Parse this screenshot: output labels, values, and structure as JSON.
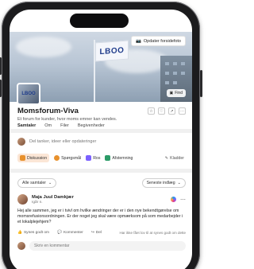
{
  "cover": {
    "update_button": "Opdater forsidefoto",
    "find_chip": "Find",
    "flag_text": "LBOO",
    "logo_text": "LBOO"
  },
  "community": {
    "title": "Momsforum-Viva",
    "description": "Et forum for kunder, hvor moms emner kan vendes.",
    "tabs": [
      "Samtaler",
      "Om",
      "Filer",
      "Begivenheder"
    ]
  },
  "composer": {
    "placeholder": "Del tanker, ideer eller opdateringer",
    "post_types": [
      "Diskussion",
      "Spørgsmål",
      "Ros",
      "Afstemning"
    ],
    "drafts_label": "Kladder"
  },
  "filter": {
    "all_conversations": "Alle samtaler",
    "sort": "Seneste indlæg"
  },
  "post": {
    "author": "Maja Juul Damkjær",
    "time": "Igår n.",
    "body": "Hej alle sammen, jeg er i tvivl om hvilke ændringer der er i den nye bekendtgørelse om momsrefusionsordningen. Er der noget jeg skal være opmærksom på som medarbejder i et lokalplejehjem?",
    "actions": [
      "Synes godt om",
      "Kommenter",
      "Del"
    ],
    "seen_by": "Har ikke fået lov til at synes godt om dette",
    "comment_placeholder": "Skriv en kommentar"
  },
  "colors": {
    "accent": "#5b5fc7",
    "discussion_bg": "#fbe6d6",
    "question_icon": "#e8912d",
    "praise_icon": "#7b61ff",
    "poll_icon": "#2c9b68"
  }
}
